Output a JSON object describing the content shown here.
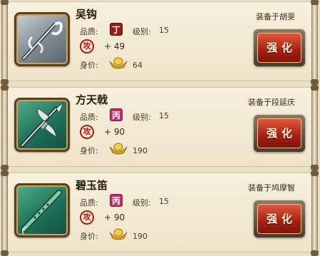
{
  "items": [
    {
      "name": "吴钩",
      "quality_label": "品质:",
      "grade": "丁",
      "level_label": "级别:",
      "level": "15",
      "attack_glyph": "攻",
      "attack": "+ 49",
      "price_label": "身价:",
      "price": "64",
      "equipped_text": "装备于胡斐",
      "button_label": "强化",
      "icon": "hook-sword-icon"
    },
    {
      "name": "方天戟",
      "quality_label": "品质:",
      "grade": "丙",
      "level_label": "级别:",
      "level": "15",
      "attack_glyph": "攻",
      "attack": "+ 90",
      "price_label": "身价:",
      "price": "190",
      "equipped_text": "装备于段延庆",
      "button_label": "强化",
      "icon": "halberd-icon"
    },
    {
      "name": "碧玉笛",
      "quality_label": "品质:",
      "grade": "丙",
      "level_label": "级别:",
      "level": "15",
      "attack_glyph": "攻",
      "attack": "+ 90",
      "price_label": "身价:",
      "price": "190",
      "equipped_text": "装备于鸠摩智",
      "button_label": "强化",
      "icon": "jade-flute-icon"
    }
  ],
  "colors": {
    "grade_ding": "#9b1a10",
    "grade_bing": "#c0306a",
    "button": "#a51f12"
  }
}
